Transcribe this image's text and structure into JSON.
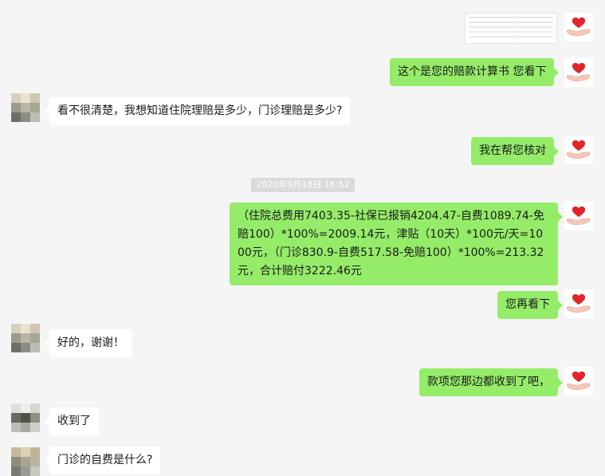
{
  "messages": [
    {
      "id": 1,
      "side": "out",
      "kind": "image",
      "alt": ""
    },
    {
      "id": 2,
      "side": "out",
      "text": "这个是您的赔款计算书  您看下"
    },
    {
      "id": 3,
      "side": "in",
      "text": "看不很清楚，我想知道住院理赔是多少，门诊理赔是多少?"
    },
    {
      "id": 4,
      "side": "out",
      "text": "我在帮您核对"
    },
    {
      "id": 5,
      "kind": "timestamp",
      "text": "2020年9月18日 16:52"
    },
    {
      "id": 6,
      "side": "out",
      "text": "（住院总费用7403.35-社保已报销4204.47-自费1089.74-免赔100）*100%=2009.14元，津贴（10天）*100元/天=1000元，（门诊830.9-自费517.58-免赔100）*100%=213.32元，合计赔付3222.46元"
    },
    {
      "id": 7,
      "side": "out",
      "text": "您再看下"
    },
    {
      "id": 8,
      "side": "in",
      "text": "好的，谢谢！"
    },
    {
      "id": 9,
      "side": "out",
      "text": "款项您那边都收到了吧，"
    },
    {
      "id": 10,
      "side": "in",
      "text": "收到了"
    },
    {
      "id": 11,
      "side": "in",
      "text": "门诊的自费是什么?"
    }
  ],
  "colors": {
    "background": "#f5f5f5",
    "bubble_out": "#95ec69",
    "bubble_in": "#ffffff",
    "timestamp_bg": "#dadada",
    "heart": "#e0262b"
  },
  "icons": {
    "self_avatar": "heart-in-hand-icon",
    "other_avatar": "pixelated-avatar"
  }
}
